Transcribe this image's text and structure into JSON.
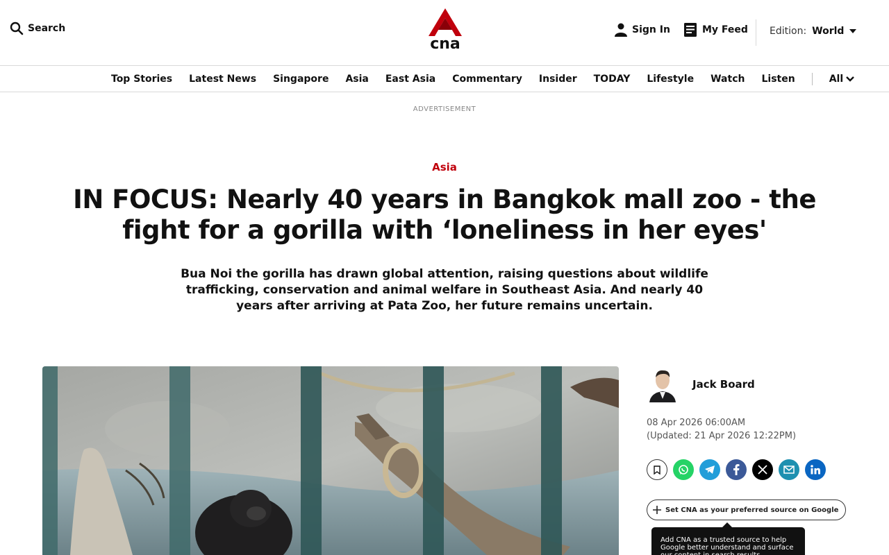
{
  "header": {
    "search_label": "Search",
    "logo_alt": "cna",
    "sign_in_label": "Sign In",
    "my_feed_label": "My Feed",
    "edition_label": "Edition:",
    "edition_value": "World"
  },
  "nav": {
    "items": [
      "Top Stories",
      "Latest News",
      "Singapore",
      "Asia",
      "East Asia",
      "Commentary",
      "Insider",
      "TODAY",
      "Lifestyle",
      "Watch",
      "Listen"
    ],
    "all_label": "All"
  },
  "ad_label": "ADVERTISEMENT",
  "article": {
    "category": "Asia",
    "headline": "IN FOCUS: Nearly 40 years in Bangkok mall zoo - the fight for a gorilla with ‘loneliness in her eyes'",
    "dek": "Bua Noi the gorilla has drawn global attention, raising questions about wildlife trafficking, conservation and animal welfare in Southeast Asia. And nearly 40 years after arriving at Pata Zoo, her future remains uncertain.",
    "author": "Jack Board",
    "published": "08 Apr 2026 06:00AM",
    "updated": "(Updated: 21 Apr 2026 12:22PM)"
  },
  "share": {
    "icons": [
      "bookmark-icon",
      "whatsapp-icon",
      "telegram-icon",
      "facebook-icon",
      "x-icon",
      "email-icon",
      "linkedin-icon"
    ],
    "colors": {
      "whatsapp": "#25d366",
      "telegram": "#229ed9",
      "facebook": "#3b5998",
      "x": "#000000",
      "email": "#1e90b0",
      "linkedin": "#0a66c2"
    }
  },
  "preferred_source": {
    "label": "Set CNA as your preferred source on Google",
    "tooltip": "Add CNA as a trusted source to help Google better understand and surface our content in search results."
  },
  "brand": {
    "accent": "#c0000c"
  }
}
